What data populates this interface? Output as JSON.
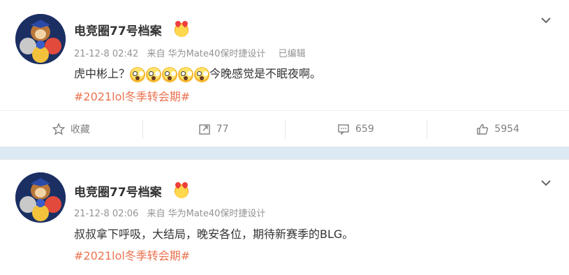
{
  "posts": [
    {
      "author": "电竞圈77号档案",
      "time": "21-12-8 02:42",
      "source": "来自 华为Mate40保时捷设计",
      "edited": "已编辑",
      "text_before": "虎中彬上？",
      "text_after": "今晚感觉是不眠夜啊。",
      "emoji_count": 5,
      "topic": "#2021lol冬季转会期#",
      "actions": {
        "favorite": "收藏",
        "repost": "77",
        "comment": "659",
        "like": "5954"
      }
    },
    {
      "author": "电竞圈77号档案",
      "time": "21-12-8 02:06",
      "source": "来自 华为Mate40保时捷设计",
      "text": "叔叔拿下呼吸，大结局，晚安各位，期待新赛季的BLG。",
      "topic": "#2021lol冬季转会期#"
    }
  ],
  "colors": {
    "topic": "#eb7350",
    "background": "#dce9f2",
    "meta": "#939393"
  },
  "icons": [
    "star-icon",
    "repost-icon",
    "comment-icon",
    "like-icon",
    "chevron-down-icon"
  ]
}
